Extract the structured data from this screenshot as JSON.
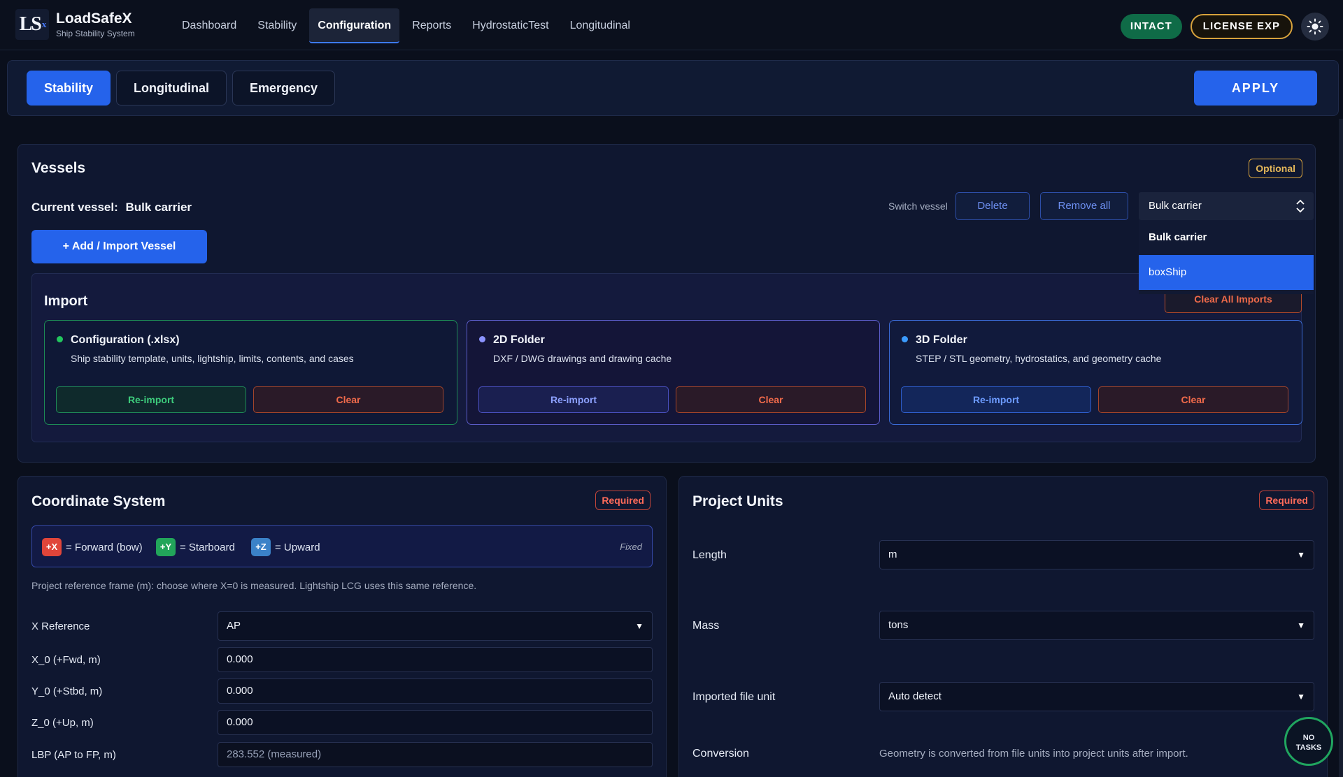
{
  "app": {
    "logo_text": "LS",
    "logo_sub": "x",
    "title": "LoadSafeX",
    "subtitle": "Ship Stability System"
  },
  "nav": {
    "items": [
      {
        "label": "Dashboard",
        "active": false
      },
      {
        "label": "Stability",
        "active": false
      },
      {
        "label": "Configuration",
        "active": true
      },
      {
        "label": "Reports",
        "active": false
      },
      {
        "label": "HydrostaticTest",
        "active": false
      },
      {
        "label": "Longitudinal",
        "active": false
      }
    ]
  },
  "header": {
    "status": "INTACT",
    "license": "LICENSE EXP",
    "theme_icon": "sun-icon"
  },
  "subtabs": {
    "items": [
      "Stability",
      "Longitudinal",
      "Emergency"
    ],
    "active_index": 0,
    "apply_label": "APPLY"
  },
  "vessels": {
    "title": "Vessels",
    "badge": "Optional",
    "current_label": "Current vessel:",
    "current_name": "Bulk carrier",
    "add_button": "+  Add / Import Vessel",
    "switch_label": "Switch vessel",
    "delete_label": "Delete",
    "remove_all_label": "Remove all",
    "select_value": "Bulk carrier",
    "options": [
      "Bulk carrier",
      "boxShip"
    ],
    "highlighted_option": "boxShip"
  },
  "import": {
    "title": "Import",
    "clear_all": "Clear All Imports",
    "cards": [
      {
        "title": "Configuration (.xlsx)",
        "desc": "Ship stability template, units, lightship, limits, contents, and cases",
        "reimport": "Re-import",
        "clear": "Clear",
        "dot_color": "#22c55e"
      },
      {
        "title": "2D Folder",
        "desc": "DXF / DWG drawings and drawing cache",
        "reimport": "Re-import",
        "clear": "Clear",
        "dot_color": "#8b93ff"
      },
      {
        "title": "3D Folder",
        "desc": "STEP / STL geometry, hydrostatics, and geometry cache",
        "reimport": "Re-import",
        "clear": "Clear",
        "dot_color": "#3b9bff"
      }
    ]
  },
  "coordinate_system": {
    "title": "Coordinate System",
    "badge": "Required",
    "axes": [
      {
        "chip": "+X",
        "label": "= Forward (bow)",
        "color": "#e0453a"
      },
      {
        "chip": "+Y",
        "label": "= Starboard",
        "color": "#22a55a"
      },
      {
        "chip": "+Z",
        "label": "= Upward",
        "color": "#3b82c8"
      }
    ],
    "fixed": "Fixed",
    "note": "Project reference frame (m): choose where X=0 is measured. Lightship LCG uses this same reference.",
    "x_reference_label": "X Reference",
    "x_reference_value": "AP",
    "x0_label": "X_0  (+Fwd, m)",
    "x0_value": "0.000",
    "y0_label": "Y_0  (+Stbd, m)",
    "y0_value": "0.000",
    "z0_label": "Z_0  (+Up, m)",
    "z0_value": "0.000",
    "lbp_label": "LBP  (AP to FP, m)",
    "lbp_value": "283.552  (measured)"
  },
  "project_units": {
    "title": "Project Units",
    "badge": "Required",
    "length_label": "Length",
    "length_value": "m",
    "mass_label": "Mass",
    "mass_value": "tons",
    "imported_label": "Imported file unit",
    "imported_value": "Auto detect",
    "conversion_label": "Conversion",
    "conversion_note": "Geometry is converted from file units into project units after import."
  },
  "tasks": {
    "line1": "NO",
    "line2": "TASKS"
  }
}
